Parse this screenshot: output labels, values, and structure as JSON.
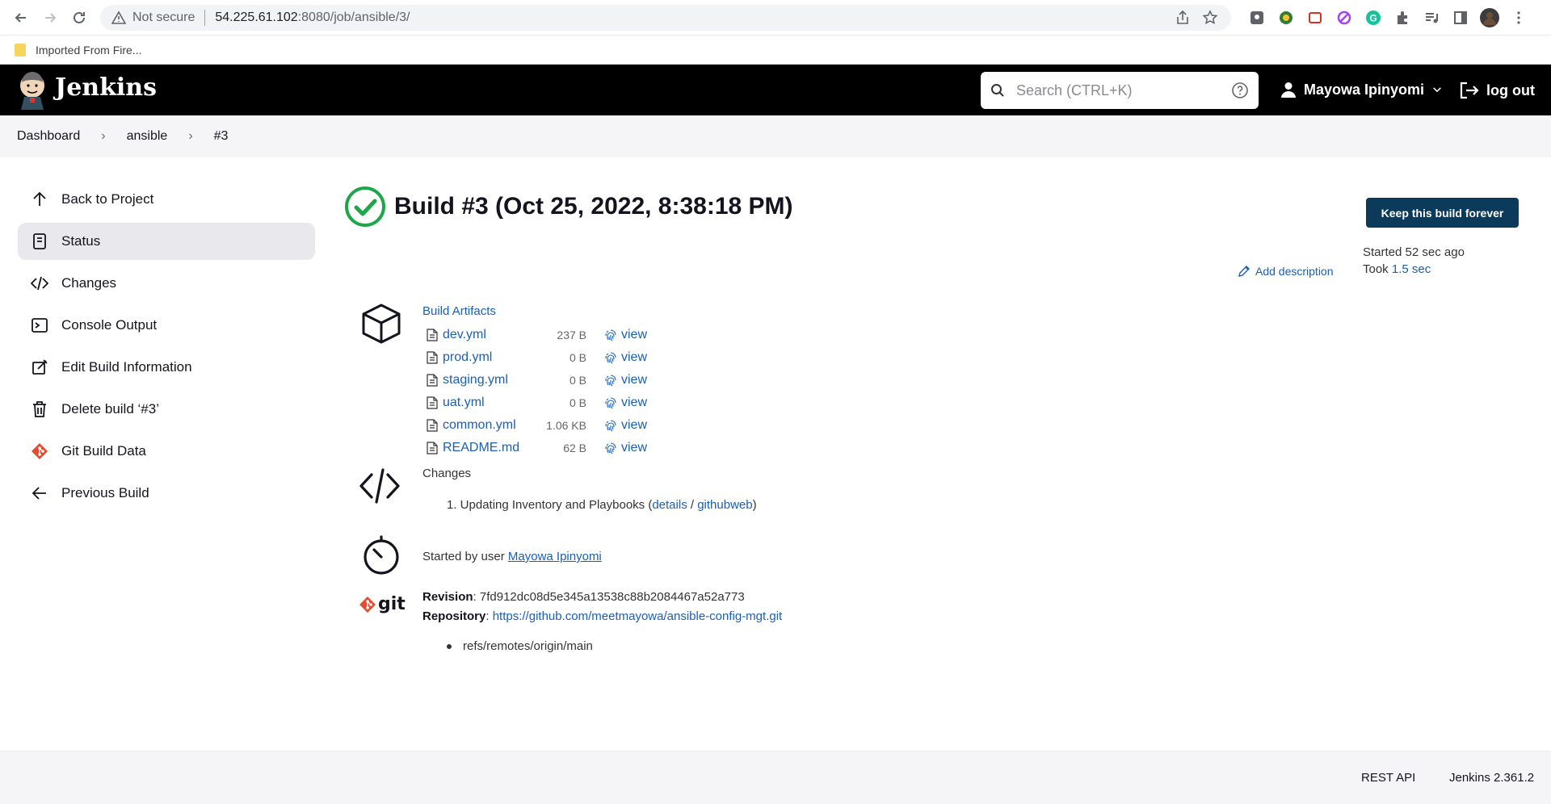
{
  "browser": {
    "security_label": "Not secure",
    "url_host": "54.225.61.102",
    "url_path": ":8080/job/ansible/3/",
    "bookmark": "Imported From Fire..."
  },
  "header": {
    "app_name": "Jenkins",
    "search_placeholder": "Search (CTRL+K)",
    "user_name": "Mayowa Ipinyomi",
    "logout_label": "log out"
  },
  "breadcrumb": [
    "Dashboard",
    "ansible",
    "#3"
  ],
  "sidebar": {
    "items": [
      {
        "label": "Back to Project",
        "icon": "arrow-up-icon"
      },
      {
        "label": "Status",
        "icon": "document-icon"
      },
      {
        "label": "Changes",
        "icon": "code-icon"
      },
      {
        "label": "Console Output",
        "icon": "terminal-icon"
      },
      {
        "label": "Edit Build Information",
        "icon": "edit-icon"
      },
      {
        "label": "Delete build ‘#3’",
        "icon": "trash-icon"
      },
      {
        "label": "Git Build Data",
        "icon": "git-icon"
      },
      {
        "label": "Previous Build",
        "icon": "arrow-left-icon"
      }
    ]
  },
  "build": {
    "title": "Build #3 (Oct 25, 2022, 8:38:18 PM)",
    "keep_label": "Keep this build forever",
    "started": "Started 52 sec ago",
    "took_prefix": "Took ",
    "took_value": "1.5 sec",
    "add_description": "Add description"
  },
  "artifacts": {
    "title": "Build Artifacts",
    "view_label": "view",
    "files": [
      {
        "name": "dev.yml",
        "size": "237 B"
      },
      {
        "name": "prod.yml",
        "size": "0 B"
      },
      {
        "name": "staging.yml",
        "size": "0 B"
      },
      {
        "name": "uat.yml",
        "size": "0 B"
      },
      {
        "name": "common.yml",
        "size": "1.06 KB"
      },
      {
        "name": "README.md",
        "size": "62 B"
      }
    ]
  },
  "changes": {
    "title": "Changes",
    "item_prefix": "1. Updating Inventory and Playbooks (",
    "details": "details",
    "slash": " / ",
    "githubweb": "githubweb",
    "item_suffix": ")"
  },
  "cause": {
    "prefix": "Started by user ",
    "user": "Mayowa Ipinyomi"
  },
  "git": {
    "logo_text": "git",
    "revision_label": "Revision",
    "revision": "7fd912dc08d5e345a13538c88b2084467a52a773",
    "repository_label": "Repository",
    "repository": "https://github.com/meetmayowa/ansible-config-mgt.git",
    "ref": "refs/remotes/origin/main"
  },
  "footer": {
    "rest_api": "REST API",
    "version": "Jenkins 2.361.2"
  },
  "colors": {
    "link": "#1a5fb4",
    "success": "#1ea64b",
    "keep_button": "#0b3a5a",
    "git_orange": "#e44c30"
  }
}
